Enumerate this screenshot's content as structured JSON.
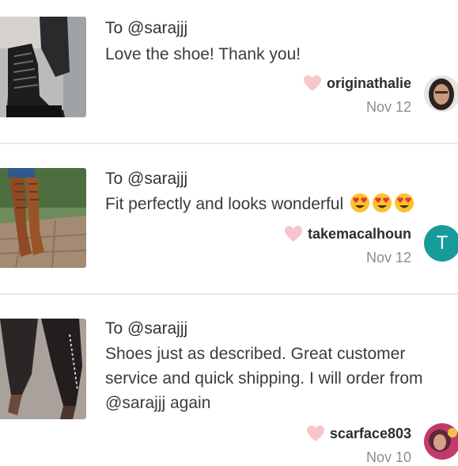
{
  "reviews": [
    {
      "to": "To @sarajjj",
      "message": "Love the shoe! Thank you!",
      "username": "originathalie",
      "date": "Nov 12",
      "thumbnail": "black-lace-up-boots-photo",
      "avatar": "user-photo"
    },
    {
      "to": "To @sarajjj",
      "message": "Fit perfectly and looks wonderful",
      "emojis": [
        "heart-eyes-emoji",
        "heart-eyes-emoji",
        "heart-eyes-emoji"
      ],
      "username": "takemacalhoun",
      "date": "Nov 12",
      "thumbnail": "brown-knee-high-boots-photo",
      "avatar_letter": "T"
    },
    {
      "to": "To @sarajjj",
      "message": "Shoes just as described. Great customer service and quick shipping. I will order from @sarajjj again",
      "username": "scarface803",
      "date": "Nov 10",
      "thumbnail": "black-heeled-boots-photo",
      "avatar": "user-photo"
    }
  ],
  "colors": {
    "heart": "#f7c6cb",
    "avatar_teal": "#179b9b",
    "divider": "#ebe7e2"
  }
}
